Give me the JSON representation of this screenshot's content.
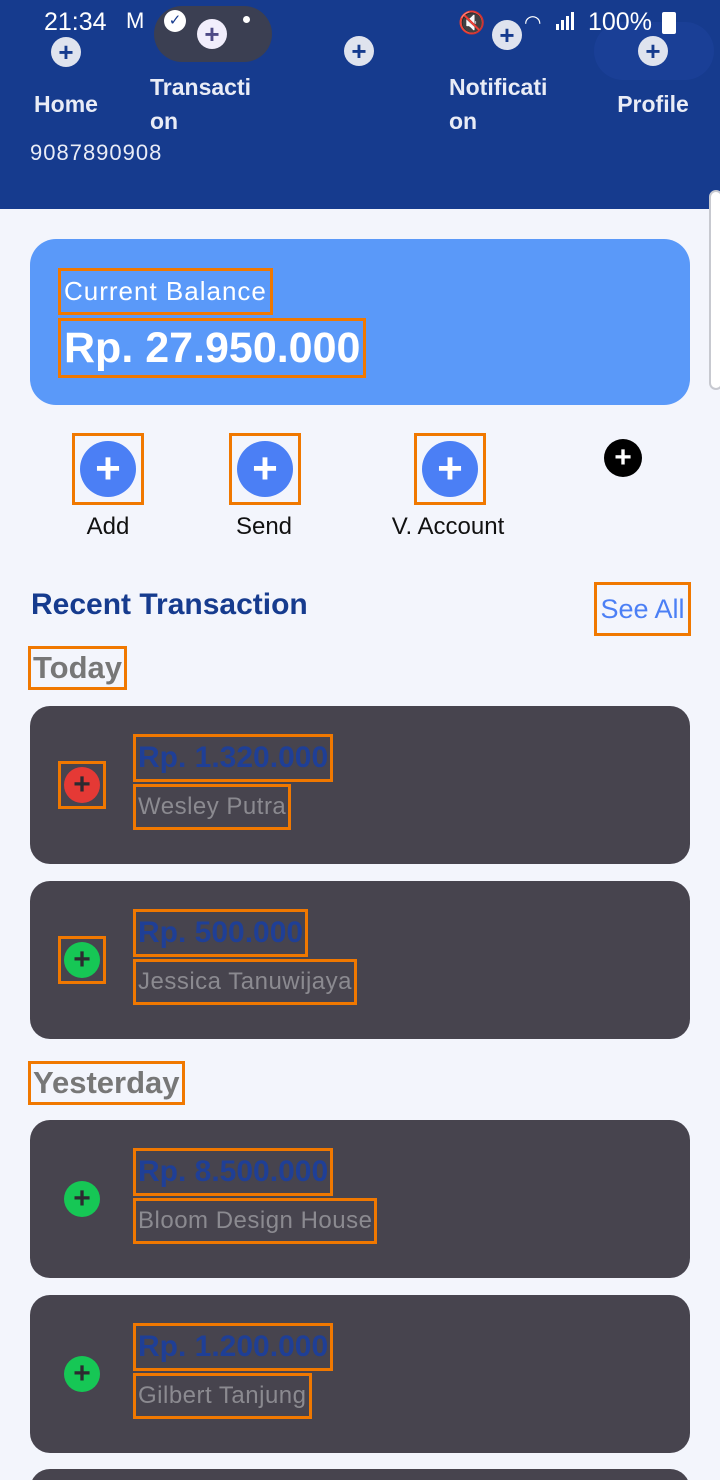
{
  "status_bar": {
    "time": "21:34",
    "mail_icon": "M",
    "battery": "100%"
  },
  "header": {
    "account_number": "9087890908",
    "nav": [
      {
        "label": "Home",
        "icon": "plus-icon"
      },
      {
        "label": "Transacti\non",
        "icon": "plus-icon",
        "active": true
      },
      {
        "label": "",
        "icon": "plus-icon"
      },
      {
        "label": "Notificati\non",
        "icon": "plus-icon"
      },
      {
        "label": "Profile",
        "icon": "plus-icon"
      }
    ]
  },
  "balance": {
    "label": "Current Balance",
    "amount": "Rp. 27.950.000"
  },
  "quick_actions": [
    {
      "label": "Add",
      "icon": "plus-icon"
    },
    {
      "label": "Send",
      "icon": "plus-icon"
    },
    {
      "label": "V. Account",
      "icon": "plus-icon"
    }
  ],
  "recent": {
    "title": "Recent Transaction",
    "see_all": "See All",
    "groups": [
      {
        "day": "Today",
        "items": [
          {
            "amount": "Rp. 1.320.000",
            "name": "Wesley Putra",
            "type": "outgoing"
          },
          {
            "amount": "Rp. 500.000",
            "name": "Jessica Tanuwijaya",
            "type": "incoming"
          }
        ]
      },
      {
        "day": "Yesterday",
        "items": [
          {
            "amount": "Rp. 8.500.000",
            "name": "Bloom Design House",
            "type": "incoming"
          },
          {
            "amount": "Rp. 1.200.000",
            "name": "Gilbert Tanjung",
            "type": "incoming"
          }
        ]
      }
    ]
  },
  "colors": {
    "header_bg": "#163b8e",
    "balance_card": "#5a99f9",
    "action_blue": "#4b7ff5",
    "card_bg": "#47444e",
    "outgoing": "#e53935",
    "incoming": "#16c755",
    "highlight_box": "#f07800"
  }
}
